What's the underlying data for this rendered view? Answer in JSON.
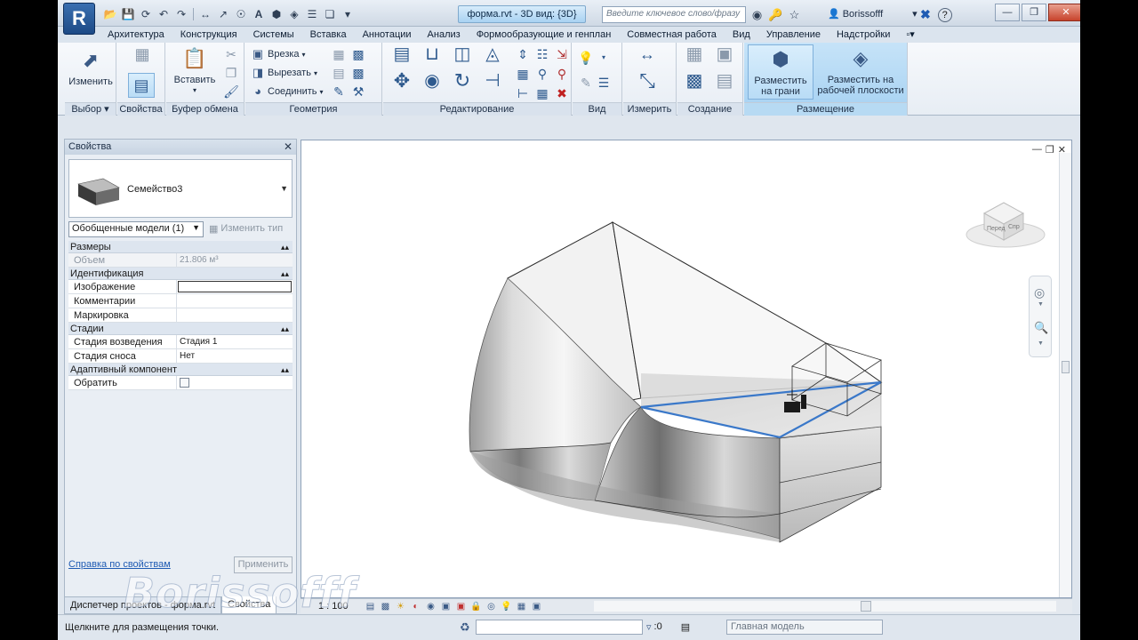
{
  "window": {
    "logo_letter": "R",
    "doc_tab": "форма.rvt - 3D вид: {3D}",
    "search_placeholder": "Введите ключевое слово/фразу",
    "user_name": "Borissofff",
    "help_label": "?"
  },
  "ribbon_tabs": [
    {
      "label": "Архитектура"
    },
    {
      "label": "Конструкция"
    },
    {
      "label": "Системы"
    },
    {
      "label": "Вставка"
    },
    {
      "label": "Аннотации"
    },
    {
      "label": "Анализ"
    },
    {
      "label": "Формообразующие и генплан"
    },
    {
      "label": "Совместная работа"
    },
    {
      "label": "Вид"
    },
    {
      "label": "Управление"
    },
    {
      "label": "Надстройки"
    }
  ],
  "ribbon": {
    "modify_label": "Изменить",
    "paste_label": "Вставить",
    "cut_label": "Врезка",
    "cutout_label": "Вырезать",
    "join_label": "Соединить",
    "place_on_face_label": "Разместить на грани",
    "place_on_workplane_label": "Разместить на рабочей плоскости",
    "panels": {
      "select": "Выбор",
      "properties": "Свойства",
      "clipboard": "Буфер обмена",
      "geometry": "Геометрия",
      "modify": "Редактирование",
      "view": "Вид",
      "measure": "Измерить",
      "create": "Создание",
      "placement": "Размещение"
    }
  },
  "properties": {
    "title": "Свойства",
    "type_name": "Семейство3",
    "filter": "Обобщенные модели (1)",
    "edit_type": "Изменить тип",
    "groups": {
      "dimensions": "Размеры",
      "identity": "Идентификация",
      "phasing": "Стадии",
      "adaptive": "Адаптивный компонент"
    },
    "rows": {
      "volume": {
        "name": "Объем",
        "value": "21.806 м³"
      },
      "image": {
        "name": "Изображение",
        "value": ""
      },
      "comments": {
        "name": "Комментарии",
        "value": ""
      },
      "mark": {
        "name": "Маркировка",
        "value": ""
      },
      "phase_created": {
        "name": "Стадия возведения",
        "value": "Стадия 1"
      },
      "phase_demolished": {
        "name": "Стадия сноса",
        "value": "Нет"
      },
      "flip": {
        "name": "Обратить",
        "value": ""
      }
    },
    "help_link": "Справка по свойствам",
    "apply": "Применить"
  },
  "palette_tabs": [
    {
      "label": "Диспетчер проектов - форма.rvt"
    },
    {
      "label": "Свойства"
    }
  ],
  "viewcube": {
    "front": "Перед",
    "right": "Спр"
  },
  "view_control": {
    "scale": "1 : 100"
  },
  "status": {
    "prompt": "Щелкните для размещения точки.",
    "filter_count": ":0",
    "model": "Главная модель"
  },
  "watermark": "Borissofff",
  "colors": {
    "accent": "#3a6fb0",
    "selection_blue": "#3a78c9",
    "placement_panel": "#a5d1f2"
  }
}
